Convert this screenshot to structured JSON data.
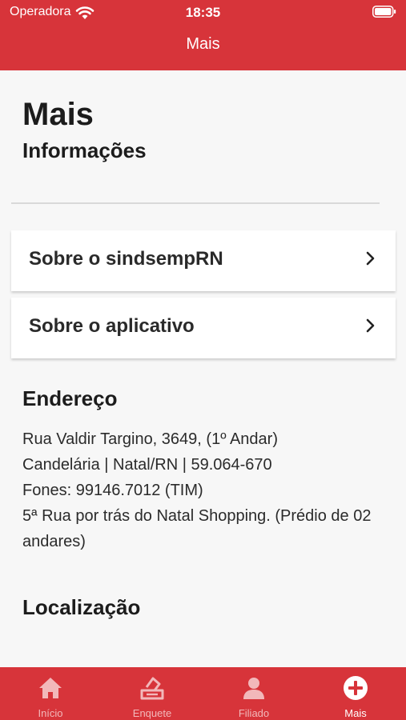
{
  "status_bar": {
    "carrier": "Operadora",
    "time": "18:35"
  },
  "nav": {
    "title": "Mais"
  },
  "page": {
    "title": "Mais",
    "section": "Informações"
  },
  "menu": [
    {
      "label": "Sobre o sindsempRN"
    },
    {
      "label": "Sobre o aplicativo"
    }
  ],
  "address": {
    "title": "Endereço",
    "lines": [
      "Rua Valdir Targino, 3649, (1º Andar)",
      "Candelária |  Natal/RN | 59.064-670",
      "Fones: 99146.7012 (TIM)",
      "5ª Rua por trás do Natal Shopping. (Prédio de 02 andares)"
    ]
  },
  "location": {
    "title": "Localização"
  },
  "tabs": [
    {
      "label": "Início",
      "icon": "home-icon"
    },
    {
      "label": "Enquete",
      "icon": "ballot-icon"
    },
    {
      "label": "Filiado",
      "icon": "person-icon"
    },
    {
      "label": "Mais",
      "icon": "plus-circle-icon",
      "active": true
    }
  ],
  "colors": {
    "brand": "#d7343a",
    "background": "#f7f7f7"
  }
}
